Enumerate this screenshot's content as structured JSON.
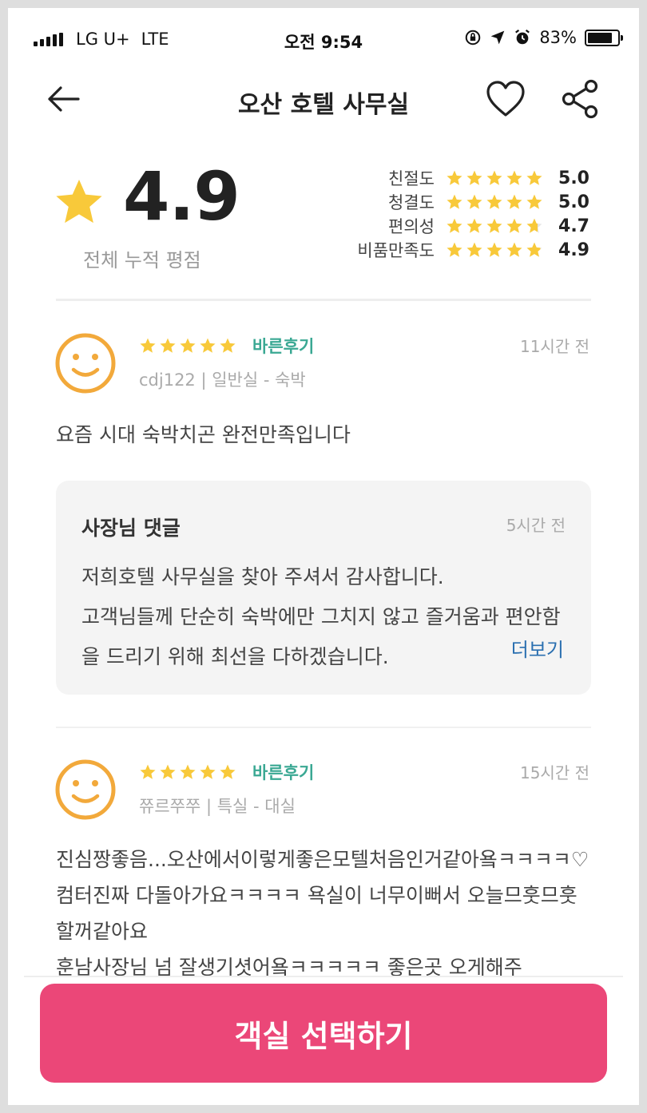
{
  "status_bar": {
    "carrier": "LG U+",
    "network": "LTE",
    "time": "오전 9:54",
    "battery": "83%",
    "battery_level": 0.83
  },
  "header": {
    "title": "오산 호텔 사무실",
    "back_icon": "arrow-left-icon",
    "favorite_icon": "heart-outline-icon",
    "share_icon": "share-icon"
  },
  "rating_summary": {
    "overall": "4.9",
    "overall_label": "전체 누적 평점",
    "categories": [
      {
        "name": "친절도",
        "value": "5.0",
        "rating": 5.0
      },
      {
        "name": "청결도",
        "value": "5.0",
        "rating": 5.0
      },
      {
        "name": "편의성",
        "value": "4.7",
        "rating": 4.7
      },
      {
        "name": "비품만족도",
        "value": "4.9",
        "rating": 4.9
      }
    ]
  },
  "reviews": [
    {
      "rating": 5,
      "badge": "바른후기",
      "time": "11시간 전",
      "user": "cdj122 | 일반실 - 숙박",
      "body": "요즘 시대 숙박치곤 완전만족입니다",
      "owner_reply": {
        "title": "사장님 댓글",
        "time": "5시간 전",
        "text": "저희호텔 사무실을 찾아 주셔서 감사합니다.\n고객님들께 단순히 숙박에만 그치지 않고 즐거움과 편안함을 드리기 위해 최선을 다하겠습니다.",
        "more_label": "더보기"
      }
    },
    {
      "rating": 5,
      "badge": "바른후기",
      "time": "15시간 전",
      "user": "쮸르쭈쭈 | 특실 - 대실",
      "body": "진심짱좋음...오산에서이렇게좋은모텔처음인거같아욬ㅋㅋㅋㅋ♡ 컴터진짜 다돌아가요ㅋㅋㅋㅋ 욕실이 너무이뻐서 오늘므훗므훗할꺼같아요\n훈남사장님 넘 잘생기셧어욬ㅋㅋㅋㅋㅋ 좋은곳 오게해주"
    }
  ],
  "cta": {
    "label": "객실 선택하기"
  },
  "colors": {
    "accent": "#eb4778",
    "star": "#f8c93a",
    "badge": "#3aa893",
    "avatar": "#f2a93b",
    "link": "#2a6fb0"
  }
}
